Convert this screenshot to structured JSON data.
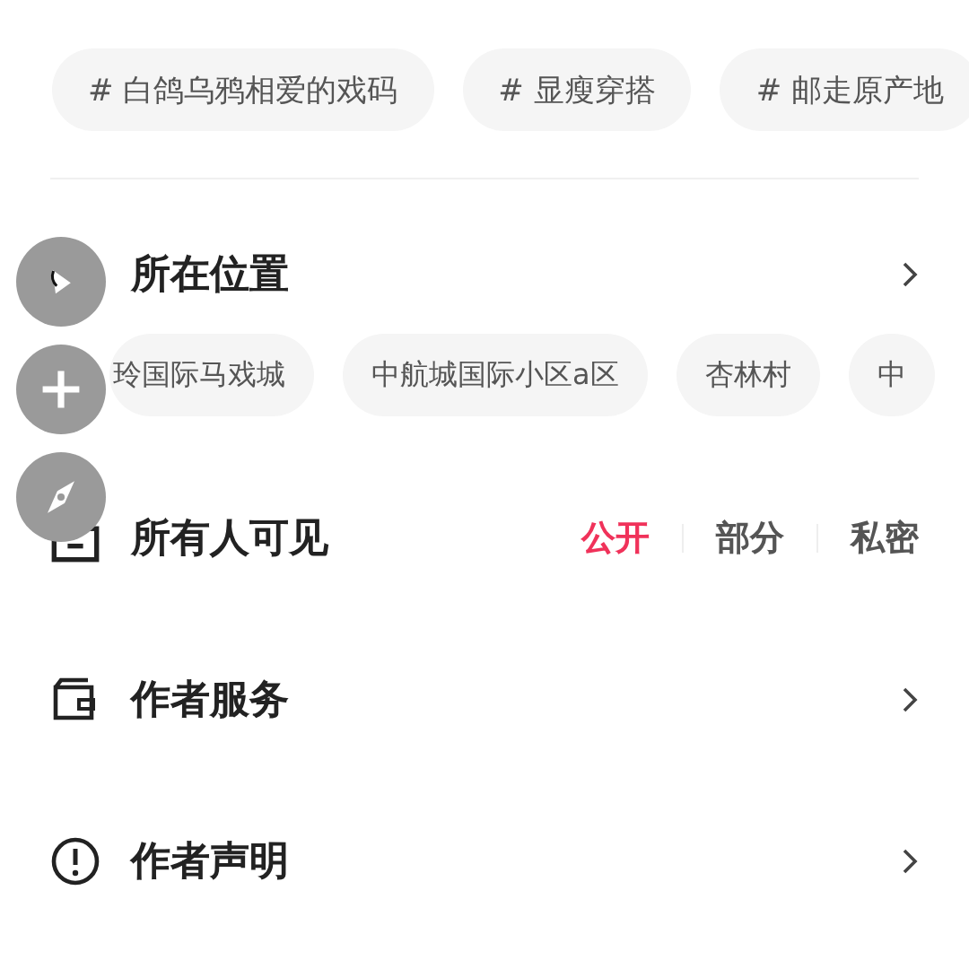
{
  "topics": [
    {
      "label": "# 白鸽乌鸦相爱的戏码"
    },
    {
      "label": "# 显瘦穿搭"
    },
    {
      "label": "# 邮走原产地"
    }
  ],
  "location": {
    "title": "所在位置",
    "suggestions": [
      "玲国际马戏城",
      "中航城国际小区a区",
      "杏林村",
      "中"
    ]
  },
  "visibility": {
    "title": "所有人可见",
    "options": [
      {
        "label": "公开",
        "selected": true
      },
      {
        "label": "部分",
        "selected": false
      },
      {
        "label": "私密",
        "selected": false
      }
    ]
  },
  "rows": [
    {
      "kind": "wallet",
      "title": "作者服务"
    },
    {
      "kind": "notice",
      "title": "作者声明"
    }
  ],
  "floating_buttons": [
    {
      "kind": "pointer"
    },
    {
      "kind": "plus"
    },
    {
      "kind": "compass"
    }
  ]
}
